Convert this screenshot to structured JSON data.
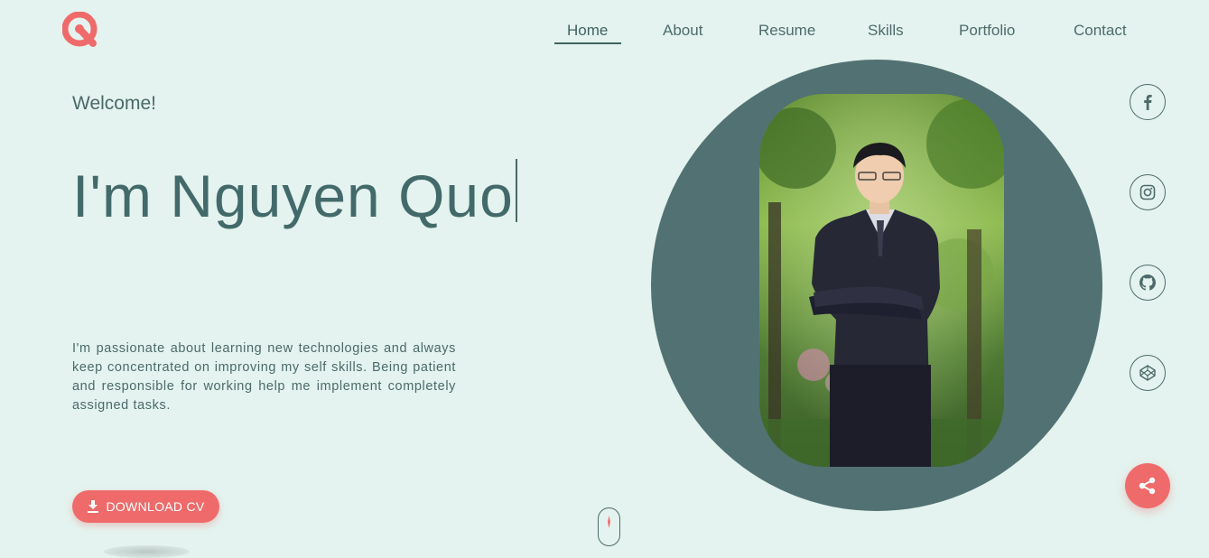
{
  "brand": {
    "logo_icon": "q-logo-icon",
    "accent_color": "#ef6b6b",
    "primary_color": "#527173"
  },
  "nav": {
    "items": [
      {
        "label": "Home",
        "active": true
      },
      {
        "label": "About",
        "active": false
      },
      {
        "label": "Resume",
        "active": false
      },
      {
        "label": "Skills",
        "active": false
      },
      {
        "label": "Portfolio",
        "active": false
      },
      {
        "label": "Contact",
        "active": false
      }
    ]
  },
  "hero": {
    "welcome": "Welcome!",
    "headline": "I'm Nguyen Quo",
    "bio": "I'm passionate about learning new technologies and always keep concentrated on improving my self skills. Being patient and responsible for working help me implement completely assigned tasks.",
    "download_label": "DOWNLOAD CV",
    "download_icon": "download-icon",
    "portrait": "profile-photo"
  },
  "social": {
    "links": [
      {
        "icon": "facebook-icon"
      },
      {
        "icon": "instagram-icon"
      },
      {
        "icon": "github-icon"
      },
      {
        "icon": "codepen-icon"
      }
    ],
    "share_icon": "share-icon"
  },
  "scroll_indicator": "mouse-scroll-icon"
}
